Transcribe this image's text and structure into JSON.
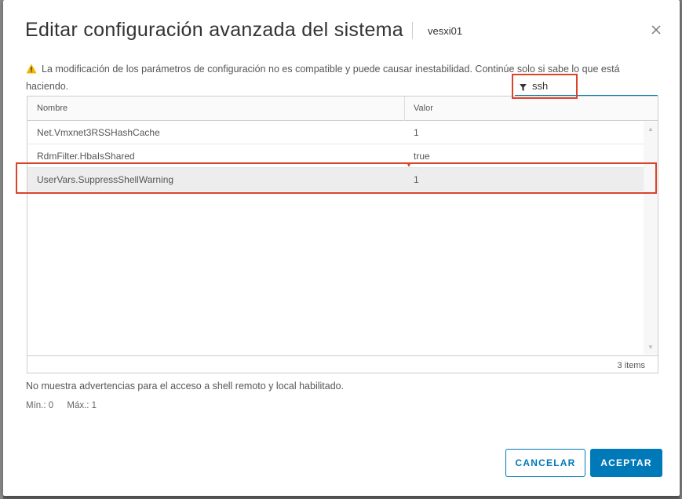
{
  "dialog": {
    "title": "Editar configuración avanzada del sistema",
    "host": "vesxi01",
    "warning": "La modificación de los parámetros de configuración no es compatible y puede causar inestabilidad. Continúe solo si sabe lo que está haciendo."
  },
  "filter": {
    "value": "ssh"
  },
  "table": {
    "columns": {
      "name": "Nombre",
      "value": "Valor"
    },
    "rows": [
      {
        "name": "Net.Vmxnet3RSSHashCache",
        "value": "1"
      },
      {
        "name": "RdmFilter.HbaIsShared",
        "value": "true"
      },
      {
        "name": "UserVars.SuppressShellWarning",
        "value": "1"
      }
    ],
    "footer": "3 items"
  },
  "details": {
    "description": "No muestra advertencias para el acceso a shell remoto y local habilitado.",
    "min": "Mín.: 0",
    "max": "Máx.: 1"
  },
  "buttons": {
    "cancel": "CANCELAR",
    "ok": "ACEPTAR"
  },
  "colors": {
    "accent": "#0079b8",
    "highlight": "#d9442b",
    "warning": "#f3b400"
  },
  "icons": [
    "close-icon",
    "warning-icon",
    "filter-icon"
  ]
}
